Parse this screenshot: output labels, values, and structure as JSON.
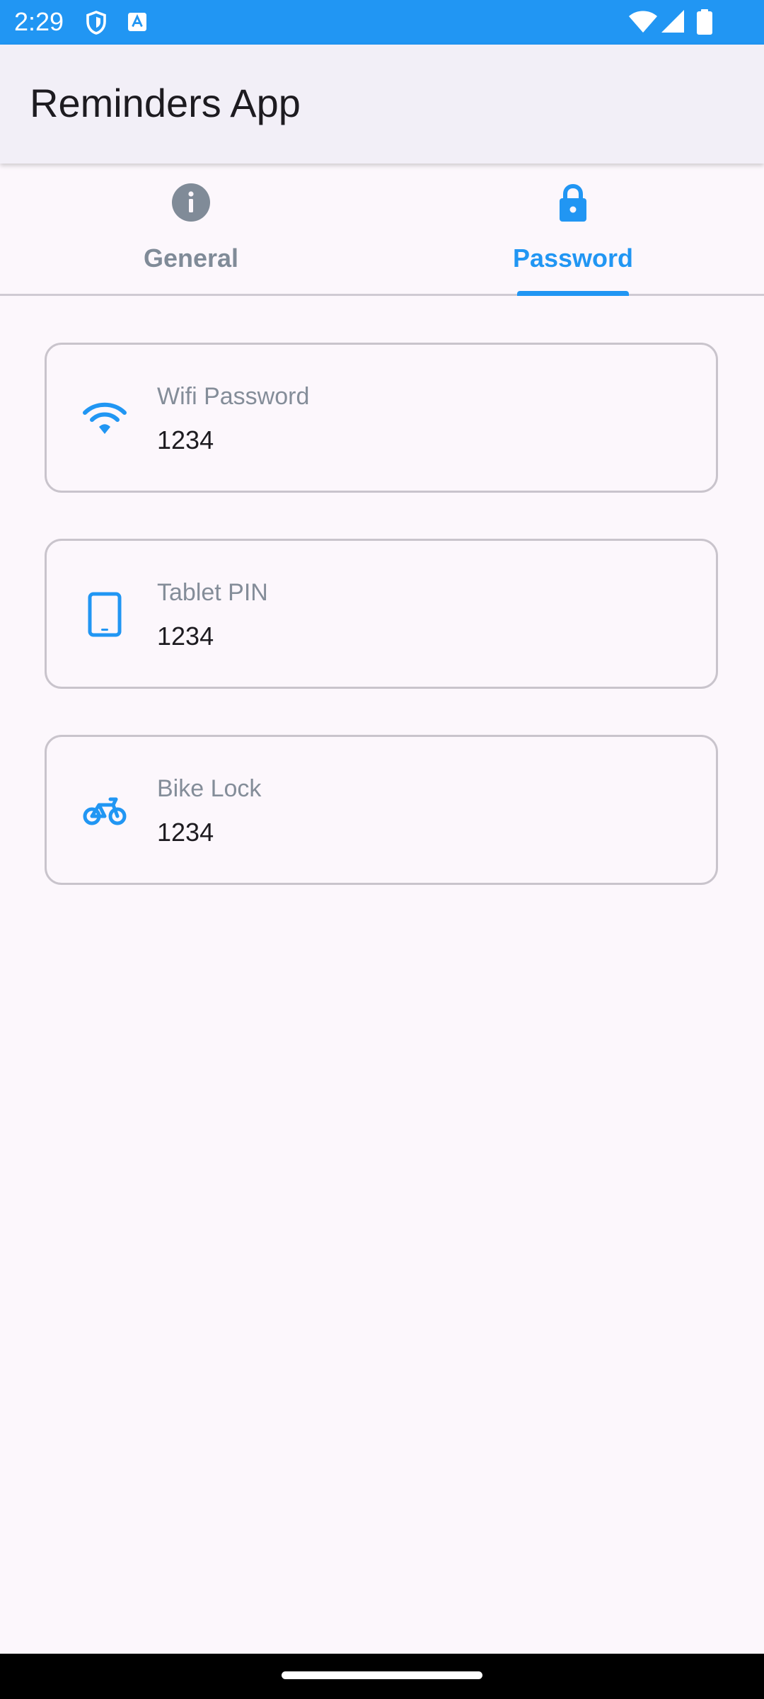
{
  "status_bar": {
    "time": "2:29",
    "color": "#2196f3",
    "left_icons": [
      "shield-icon",
      "font-a-icon"
    ],
    "right_icons": [
      "wifi-icon",
      "signal-icon",
      "battery-icon"
    ]
  },
  "app_bar": {
    "title": "Reminders App"
  },
  "tabs": [
    {
      "label": "General",
      "icon": "info-icon",
      "selected": false
    },
    {
      "label": "Password",
      "icon": "lock-icon",
      "selected": true
    }
  ],
  "accent_color": "#2196f3",
  "cards": [
    {
      "icon": "wifi-icon",
      "label": "Wifi Password",
      "value": "1234"
    },
    {
      "icon": "tablet-icon",
      "label": "Tablet PIN",
      "value": "1234"
    },
    {
      "icon": "bike-icon",
      "label": "Bike Lock",
      "value": "1234"
    }
  ]
}
